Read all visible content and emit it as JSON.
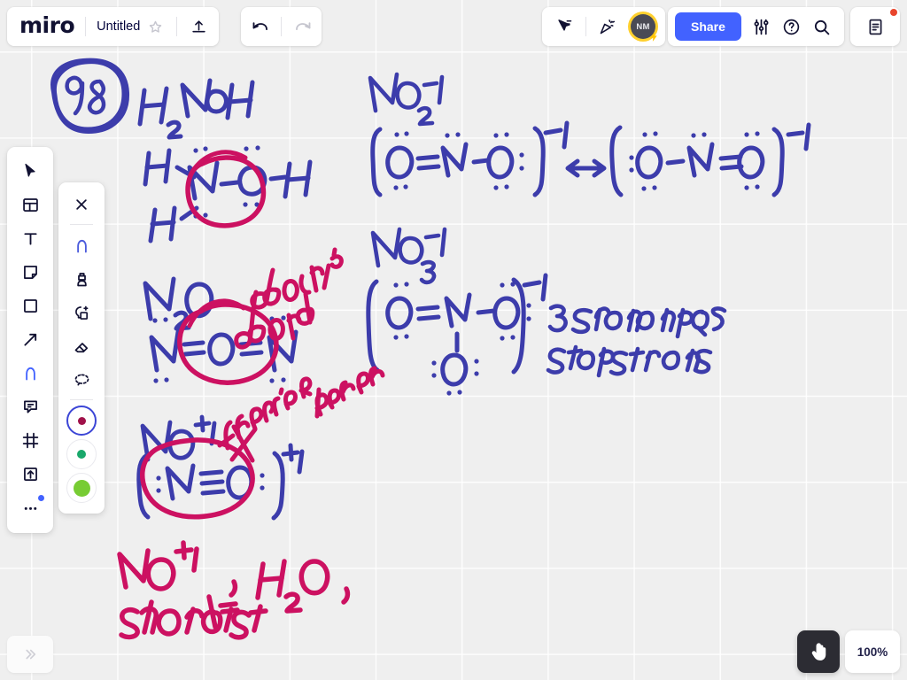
{
  "app": {
    "name": "miro",
    "zoom_level": "100%",
    "ink_blue": "#3c3cab",
    "ink_pink": "#cc1161",
    "accent_blue": "#4262ff",
    "canvas_bg": "#efefef"
  },
  "topbar": {
    "logo": "miro",
    "document_title": "Untitled",
    "favorite_icon": "star-icon",
    "upload_icon": "upload-icon",
    "undo_icon": "undo-icon",
    "redo_icon": "redo-icon",
    "cursor_icon": "cursor-share-icon",
    "celebrate_icon": "party-popper-icon",
    "avatar_initials": "NM",
    "avatar_badge_icon": "lightning-bolt-icon",
    "share_label": "Share",
    "settings_icon": "sliders-icon",
    "help_icon": "question-circle-icon",
    "search_icon": "search-icon",
    "notes_icon": "notes-document-icon",
    "notes_has_notification": true
  },
  "main_toolbar": [
    {
      "name": "select-tool",
      "icon": "cursor-arrow-icon",
      "active": false
    },
    {
      "name": "templates-tool",
      "icon": "template-layout-icon",
      "active": false
    },
    {
      "name": "text-tool",
      "icon": "text-t-icon",
      "active": false
    },
    {
      "name": "sticky-note-tool",
      "icon": "sticky-note-icon",
      "active": false
    },
    {
      "name": "shapes-tool",
      "icon": "square-shape-icon",
      "active": false
    },
    {
      "name": "connector-tool",
      "icon": "arrow-line-icon",
      "active": false
    },
    {
      "name": "pen-tool",
      "icon": "pen-marker-icon",
      "active": true
    },
    {
      "name": "comment-tool",
      "icon": "comment-bubble-icon",
      "active": false
    },
    {
      "name": "frame-tool",
      "icon": "frame-icon",
      "active": false
    },
    {
      "name": "upload-tool",
      "icon": "upload-box-icon",
      "active": false
    },
    {
      "name": "more-tools",
      "icon": "ellipsis-icon",
      "active": false
    }
  ],
  "pen_toolbar": {
    "close_icon": "close-x-icon",
    "tools": [
      {
        "name": "marker-pen-tool",
        "icon": "pen-marker-icon",
        "active": true
      },
      {
        "name": "highlighter-tool",
        "icon": "highlighter-icon",
        "active": false
      },
      {
        "name": "smart-draw-tool",
        "icon": "shape-magic-icon",
        "active": false
      },
      {
        "name": "eraser-tool",
        "icon": "eraser-icon",
        "active": false
      },
      {
        "name": "lasso-select-tool",
        "icon": "lasso-dashed-icon",
        "active": false
      }
    ],
    "swatches": [
      {
        "name": "color-swatch-crimson",
        "color": "#a0114a",
        "size": 9,
        "selected": true
      },
      {
        "name": "color-swatch-green",
        "color": "#19a86b",
        "size": 10,
        "selected": false
      },
      {
        "name": "color-swatch-light-green",
        "color": "#77cc33",
        "size": 19,
        "selected": false
      }
    ]
  },
  "bottombar": {
    "expand_icon": "chevron-double-right-icon",
    "hand_icon": "hand-pointer-icon",
    "zoom_label": "100%"
  },
  "board_content": {
    "problem_number": "98",
    "annotations_blue": [
      "H2NOH",
      "H - N - O - H  with H below (Lewis structure of hydroxylamine)",
      "NO2 -1",
      "[ :O: = N - O: ] -1  <-->  [ :O: - N = :O: ] -1",
      "N2O",
      "N = O = N",
      "NO3 -1",
      "[ :O: = N - O:  with O below ] -1",
      "3 resonance structures",
      "NO +1",
      "[ :N = O: ] +1"
    ],
    "annotations_pink": [
      "double bond",
      "triple bond",
      "NO +1 , H2O ,",
      "shortest"
    ]
  }
}
